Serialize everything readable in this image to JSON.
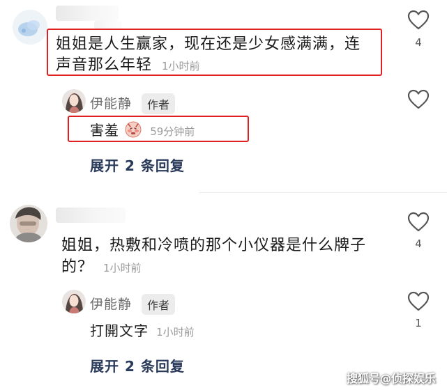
{
  "comments": [
    {
      "text_line1": "姐姐是人生赢家，现在还是少女感满满，连",
      "text_line2": "声音那么年轻",
      "time": "1小时前",
      "likes": "4",
      "reply": {
        "username": "伊能静",
        "badge": "作者",
        "text": "害羞",
        "emoji": "shy-face-emoji",
        "time": "59分钟前",
        "likes": ""
      },
      "expand_label": "展开 2 条回复"
    },
    {
      "text_line1": "姐姐，热敷和冷喷的那个小仪器是什么牌子",
      "text_line2": "的？",
      "time": "1小时前",
      "likes": "4",
      "reply": {
        "username": "伊能静",
        "badge": "作者",
        "text": "打開文字",
        "time": "1小时前",
        "likes": "1"
      },
      "expand_label": "展开 2 条回复"
    }
  ],
  "watermark": "搜狐号@侦探娱乐",
  "colors": {
    "highlight_box": "#e02020",
    "expand_link": "#2a3a5a",
    "time_gray": "#9a9a9a"
  }
}
